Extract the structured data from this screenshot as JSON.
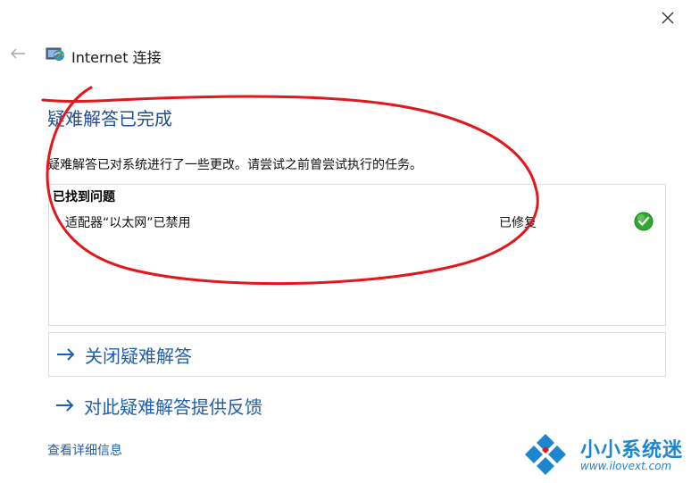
{
  "window": {
    "close_icon": "close-icon",
    "back_icon": "back-arrow-icon",
    "app_icon": "network-connection-icon",
    "title": "Internet 连接"
  },
  "main": {
    "heading": "疑难解答已完成",
    "description": "疑难解答已对系统进行了一些更改。请尝试之前曾尝试执行的任务。",
    "problems": {
      "title": "已找到问题",
      "items": [
        {
          "name": "适配器“以太网”已禁用",
          "status": "已修复",
          "status_icon": "green-checkmark-icon"
        }
      ]
    },
    "links": [
      {
        "label": "关闭疑难解答",
        "icon": "arrow-right-icon"
      },
      {
        "label": "对此疑难解答提供反馈",
        "icon": "arrow-right-icon"
      }
    ],
    "details_link": "查看详细信息"
  },
  "watermark": {
    "name": "小小系统迷",
    "url": "www.ilovext.com",
    "logo_icon": "diamond-logo-icon"
  },
  "colors": {
    "heading": "#1f4f94",
    "link": "#1f5fad",
    "annotation": "#e2161c",
    "check": "#2ea82e",
    "watermark": "#1e86cf"
  }
}
